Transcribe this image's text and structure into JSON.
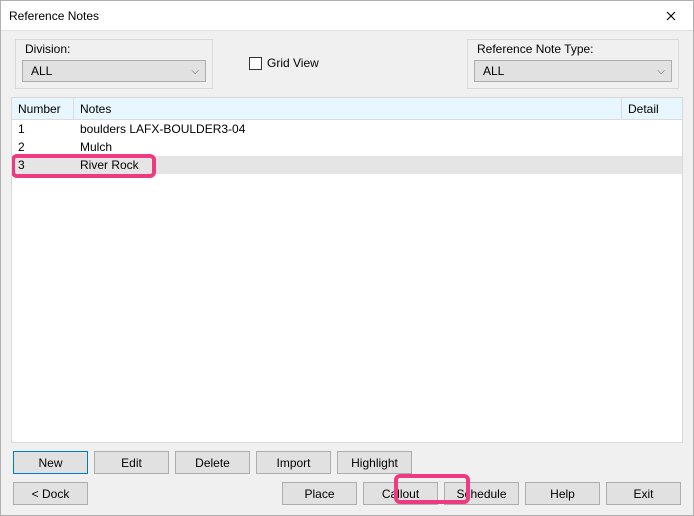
{
  "window": {
    "title": "Reference Notes"
  },
  "filters": {
    "division_label": "Division:",
    "division_value": "ALL",
    "gridview_label": "Grid View",
    "reftype_label": "Reference Note Type:",
    "reftype_value": "ALL"
  },
  "table": {
    "headers": {
      "number": "Number",
      "notes": "Notes",
      "detail": "Detail"
    },
    "rows": [
      {
        "num": "1",
        "notes": "boulders LAFX-BOULDER3-04",
        "detail": ""
      },
      {
        "num": "2",
        "notes": "Mulch",
        "detail": ""
      },
      {
        "num": "3",
        "notes": "River Rock",
        "detail": ""
      }
    ],
    "selected_index": 2
  },
  "buttons": {
    "new": "New",
    "edit": "Edit",
    "delete": "Delete",
    "import": "Import",
    "highlight": "Highlight",
    "dock": "< Dock",
    "place": "Place",
    "callout": "Callout",
    "schedule": "Schedule",
    "help": "Help",
    "exit": "Exit"
  },
  "highlights": {
    "color": "#ee3a80",
    "targets": [
      "row-3",
      "place-button"
    ]
  }
}
